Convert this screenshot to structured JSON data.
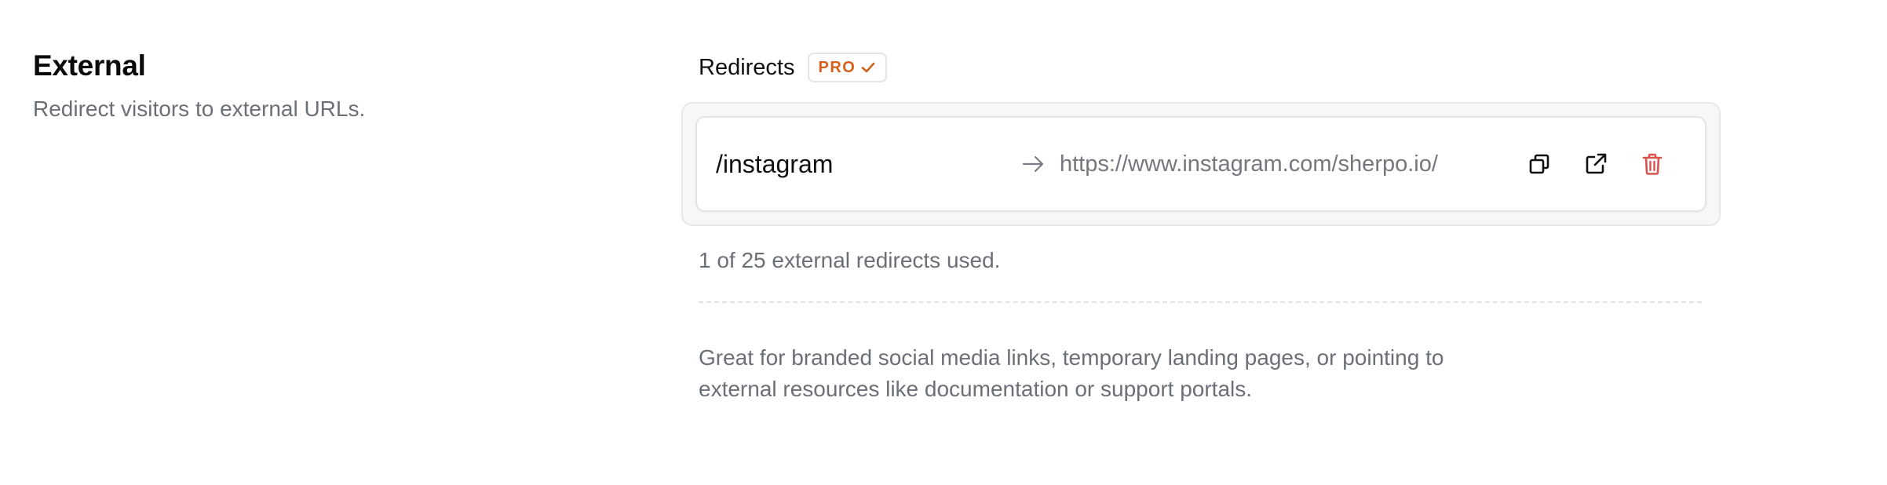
{
  "section": {
    "title": "External",
    "description": "Redirect visitors to external URLs."
  },
  "redirects": {
    "label": "Redirects",
    "badge": "PRO",
    "items": [
      {
        "path": "/instagram",
        "url": "https://www.instagram.com/sherpo.io/"
      }
    ],
    "usage": "1 of 25 external redirects used.",
    "info": "Great for branded social media links, temporary landing pages, or pointing to external resources like documentation or support portals."
  },
  "colors": {
    "badge_text": "#d4601c",
    "delete": "#d9534f",
    "muted_text": "#6b6f76"
  },
  "icons": {
    "badge": "check-icon",
    "separator": "arrow-right-icon",
    "copy": "copy-icon",
    "open": "external-link-icon",
    "delete": "trash-icon"
  }
}
